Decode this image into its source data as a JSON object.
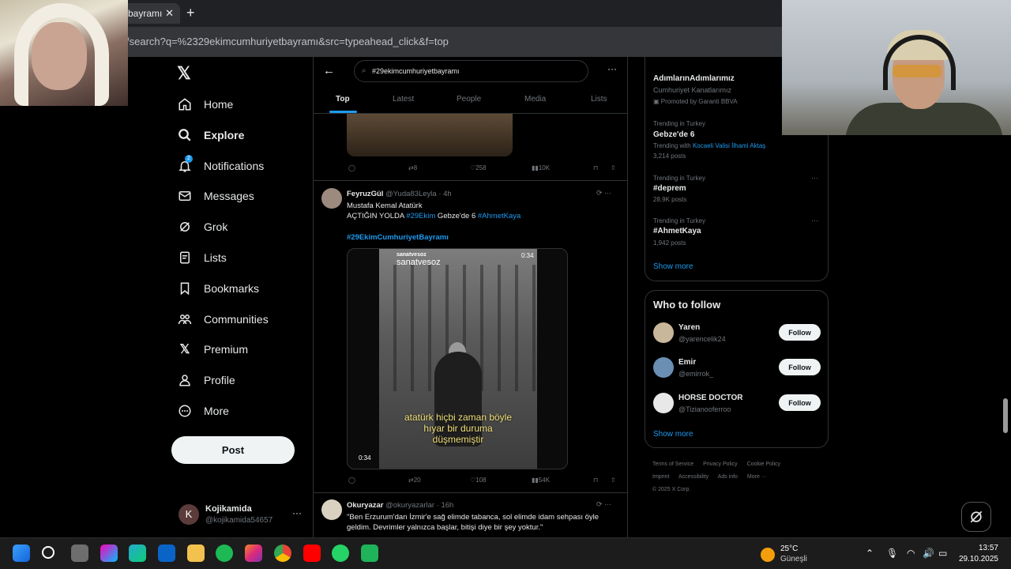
{
  "browser": {
    "tab_title": "bayramı",
    "tab_close": "✕",
    "new_tab": "+",
    "url": "/search?q=%2329ekimcumhuriyetbayramı&src=typeahead_click&f=top"
  },
  "nav": {
    "items": [
      {
        "label": "Home",
        "icon": "home-icon"
      },
      {
        "label": "Explore",
        "icon": "search-icon"
      },
      {
        "label": "Notifications",
        "icon": "bell-icon",
        "badge": "2"
      },
      {
        "label": "Messages",
        "icon": "mail-icon"
      },
      {
        "label": "Grok",
        "icon": "grok-icon"
      },
      {
        "label": "Lists",
        "icon": "list-icon"
      },
      {
        "label": "Bookmarks",
        "icon": "bookmark-icon"
      },
      {
        "label": "Communities",
        "icon": "communities-icon"
      },
      {
        "label": "Premium",
        "icon": "x-icon"
      },
      {
        "label": "Profile",
        "icon": "person-icon"
      },
      {
        "label": "More",
        "icon": "more-circle-icon"
      }
    ],
    "post_label": "Post"
  },
  "account": {
    "initial": "K",
    "name": "Kojikamida",
    "handle": "@kojikamida54657",
    "more": "···"
  },
  "search": {
    "query": "#29ekimcumhuriyetbayramı",
    "back": "←",
    "more": "···",
    "tabs": [
      "Top",
      "Latest",
      "People",
      "Media",
      "Lists"
    ]
  },
  "tweets": [
    {
      "actions": {
        "reply": "",
        "repost": "8",
        "like": "258",
        "views": "10K"
      }
    },
    {
      "name": "FeyruzGül",
      "handle": "@Yuda83Leyla · 4h",
      "line1": "Mustafa Kemal Atatürk",
      "line2_prefix": "AÇTIĞIN YOLDA ",
      "line2_tag1": "#29Ekim",
      "line2_mid": " Gebze'de 6 ",
      "line2_tag2": "#AhmetKaya",
      "hashtag": "#29EkimCumhuriyetBayramı",
      "video": {
        "watermark": "sanatvesoz",
        "watermark2": "sanatvesoz",
        "duration_top": "0:34",
        "subtitle1": "atatürk hiçbi zaman böyle",
        "subtitle2": "hıyar bir duruma",
        "subtitle3": "düşmemiştir",
        "duration_bottom": "0:34"
      },
      "actions": {
        "reply": "",
        "repost": "20",
        "like": "108",
        "views": "54K"
      }
    },
    {
      "name": "Okuryazar",
      "handle": "@okuryazarlar · 16h",
      "text1": "\"Ben Erzurum'dan İzmir'e sağ elimde tabanca, sol elimde idam sehpası öyle",
      "text2": "geldim. Devrimler yalnızca başlar, bitişi diye bir şey yoktur.\""
    }
  ],
  "trends": {
    "promoted": {
      "title": "AdımlarınAdımlarımız",
      "subtitle": "Cumhuriyet Kanatlarımız",
      "meta": "Promoted by Garanti BBVA"
    },
    "items": [
      {
        "meta": "Trending in Turkey",
        "title": "Gebze'de 6",
        "extra_prefix": "Trending with ",
        "extra_link": "Kocaeli Valisi İlhami Aktaş",
        "posts": "3,214 posts"
      },
      {
        "meta": "Trending in Turkey",
        "title": "#deprem",
        "posts": "28.9K posts"
      },
      {
        "meta": "Trending in Turkey",
        "title": "#AhmetKaya",
        "posts": "1,942 posts"
      }
    ],
    "show_more": "Show more"
  },
  "who_to_follow": {
    "title": "Who to follow",
    "users": [
      {
        "name": "Yaren",
        "handle": "@yarencelik24",
        "button": "Follow"
      },
      {
        "name": "Emir",
        "handle": "@emirrok_",
        "button": "Follow"
      },
      {
        "name": "HORSE DOCTOR",
        "handle": "@Tizianooferroo",
        "button": "Follow"
      }
    ],
    "show_more": "Show more"
  },
  "footer": {
    "links": [
      "Terms of Service",
      "Privacy Policy",
      "Cookie Policy",
      "Imprint",
      "Accessibility",
      "Ads info",
      "More ···"
    ],
    "copyright": "© 2025 X Corp."
  },
  "taskbar": {
    "weather_temp": "25°C",
    "weather_cond": "Güneşli",
    "time": "13:57",
    "date": "29.10.2025"
  },
  "colors": {
    "accent": "#1d9bf0",
    "background": "#000000",
    "border": "#2f3336"
  }
}
